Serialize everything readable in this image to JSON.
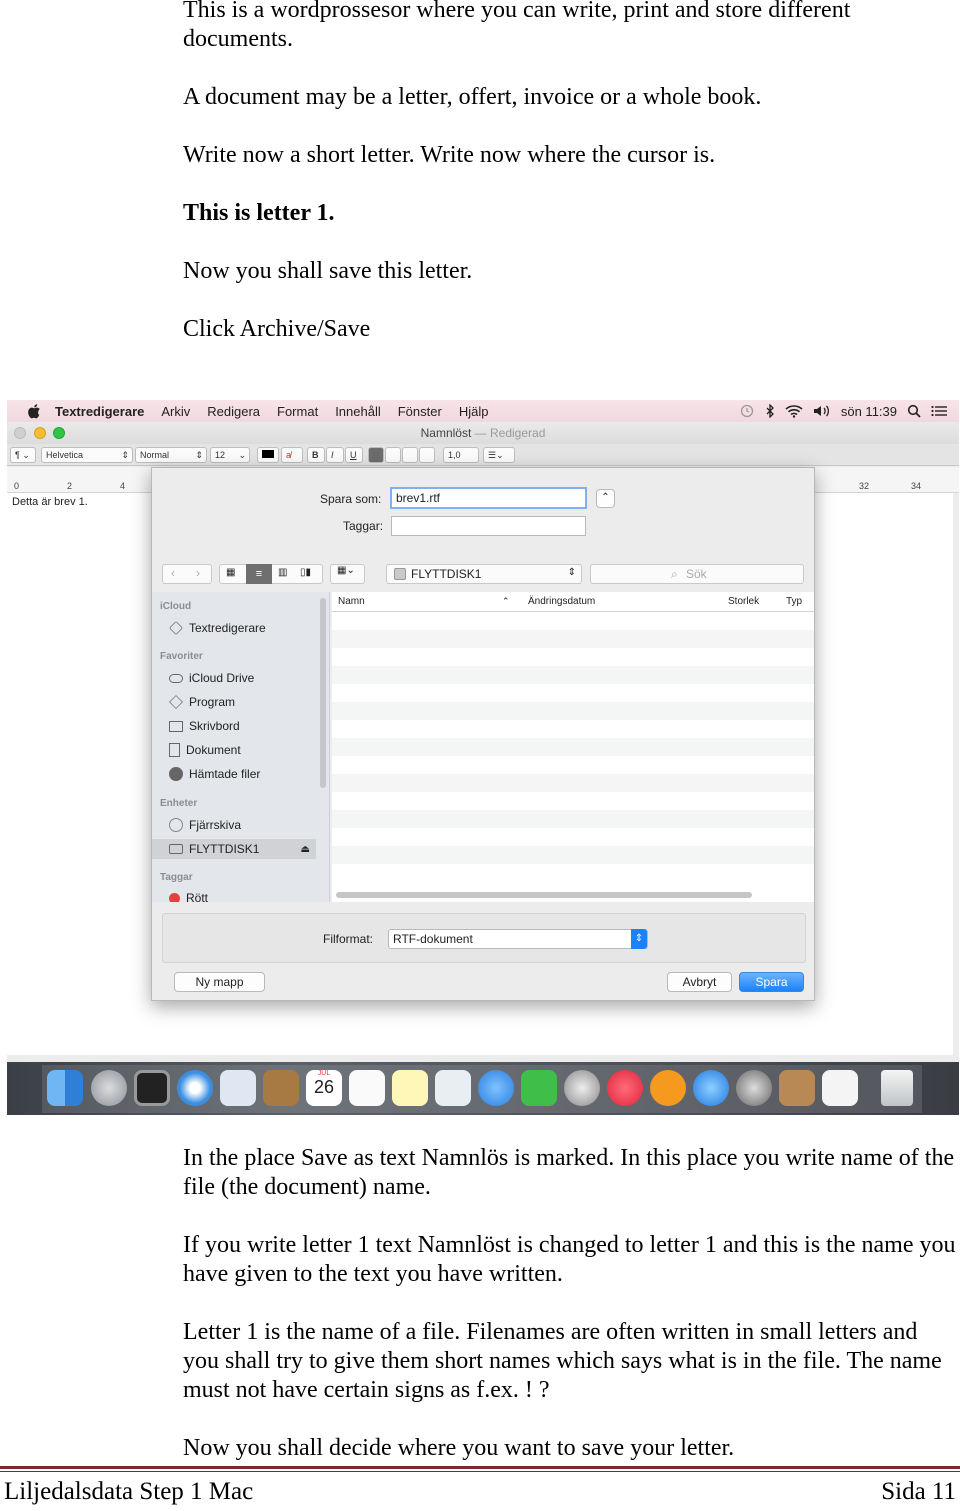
{
  "instructions_top": [
    "This is a wordprossesor where you can write, print and store different documents.",
    "A document may be a letter, offert, invoice or a whole book.",
    "Write now a short letter. Write now where the cursor is.",
    "This is letter 1.",
    "Now you shall save this letter.",
    "Click Archive/Save"
  ],
  "screenshot": {
    "menubar": {
      "app": "Textredigerare",
      "items": [
        "Arkiv",
        "Redigera",
        "Format",
        "Innehåll",
        "Fönster",
        "Hjälp"
      ],
      "clock": "sön 11:39"
    },
    "window": {
      "title": "Namnlöst",
      "title_sep": "—",
      "title_state": "Redigerad"
    },
    "toolbar": {
      "paragraph": "¶",
      "font": "Helvetica",
      "style": "Normal",
      "size": "12",
      "bold": "B",
      "italic": "I",
      "underline": "U",
      "spacing": "1,0"
    },
    "ruler": {
      "ticks": [
        "0",
        "2",
        "4",
        "32",
        "34"
      ]
    },
    "document_text": "Detta är brev 1.",
    "save_dialog": {
      "save_as_label": "Spara som:",
      "save_as_value": "brev1.rtf",
      "tags_label": "Taggar:",
      "location": "FLYTTDISK1",
      "search_placeholder": "Sök",
      "sidebar": {
        "icloud_header": "iCloud",
        "icloud_items": [
          "Textredigerare"
        ],
        "favorites_header": "Favoriter",
        "favorites_items": [
          "iCloud Drive",
          "Program",
          "Skrivbord",
          "Dokument",
          "Hämtade filer"
        ],
        "devices_header": "Enheter",
        "devices_items": [
          "Fjärrskiva",
          "FLYTTDISK1"
        ],
        "tags_header": "Taggar",
        "tags_items": [
          "Rött"
        ]
      },
      "columns": {
        "name": "Namn",
        "modified": "Ändringsdatum",
        "size": "Storlek",
        "type": "Typ"
      },
      "format_label": "Filformat:",
      "format_value": "RTF-dokument",
      "new_folder": "Ny mapp",
      "cancel": "Avbryt",
      "save": "Spara"
    },
    "dock": {
      "calendar_day": "26",
      "calendar_month": "JUL"
    }
  },
  "instructions_bottom": [
    "In the place Save as text Namnlös is marked. In this place you write name of the file  (the document) name.",
    "If you write letter 1 text Namnlöst is changed to letter 1 and this is the name you have given to the text you have written.",
    "Letter 1 is the name of a file. Filenames are often written in small letters and you shall try to give them short names which says what is in the file. The name must not have certain signs as f.ex. ! ?",
    "Now you shall decide where you want to save your letter."
  ],
  "footer": {
    "left": "Liljedalsdata Step 1 Mac",
    "right": "Sida 11"
  }
}
